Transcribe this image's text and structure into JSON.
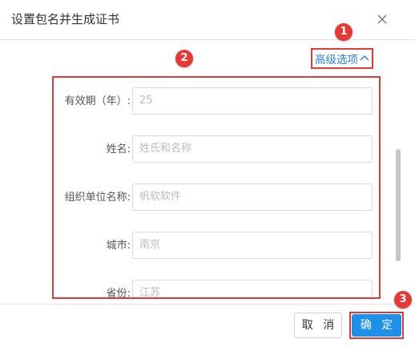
{
  "dialog": {
    "title": "设置包名并生成证书",
    "advanced_label": "高级选项",
    "fields": [
      {
        "label": "有效期（年）:",
        "value": "25"
      },
      {
        "label": "姓名:",
        "value": "姓氏和名称"
      },
      {
        "label": "组织单位名称:",
        "value": "帆软软件"
      },
      {
        "label": "城市:",
        "value": "南京"
      },
      {
        "label": "省份:",
        "value": "江苏"
      }
    ],
    "buttons": {
      "cancel": "取 消",
      "ok": "确 定"
    }
  },
  "badges": [
    "1",
    "2",
    "3"
  ],
  "colors": {
    "accent": "#1e90ea",
    "highlight": "#e03b3b",
    "badge": "#e53935",
    "link": "#2a7fd4"
  }
}
